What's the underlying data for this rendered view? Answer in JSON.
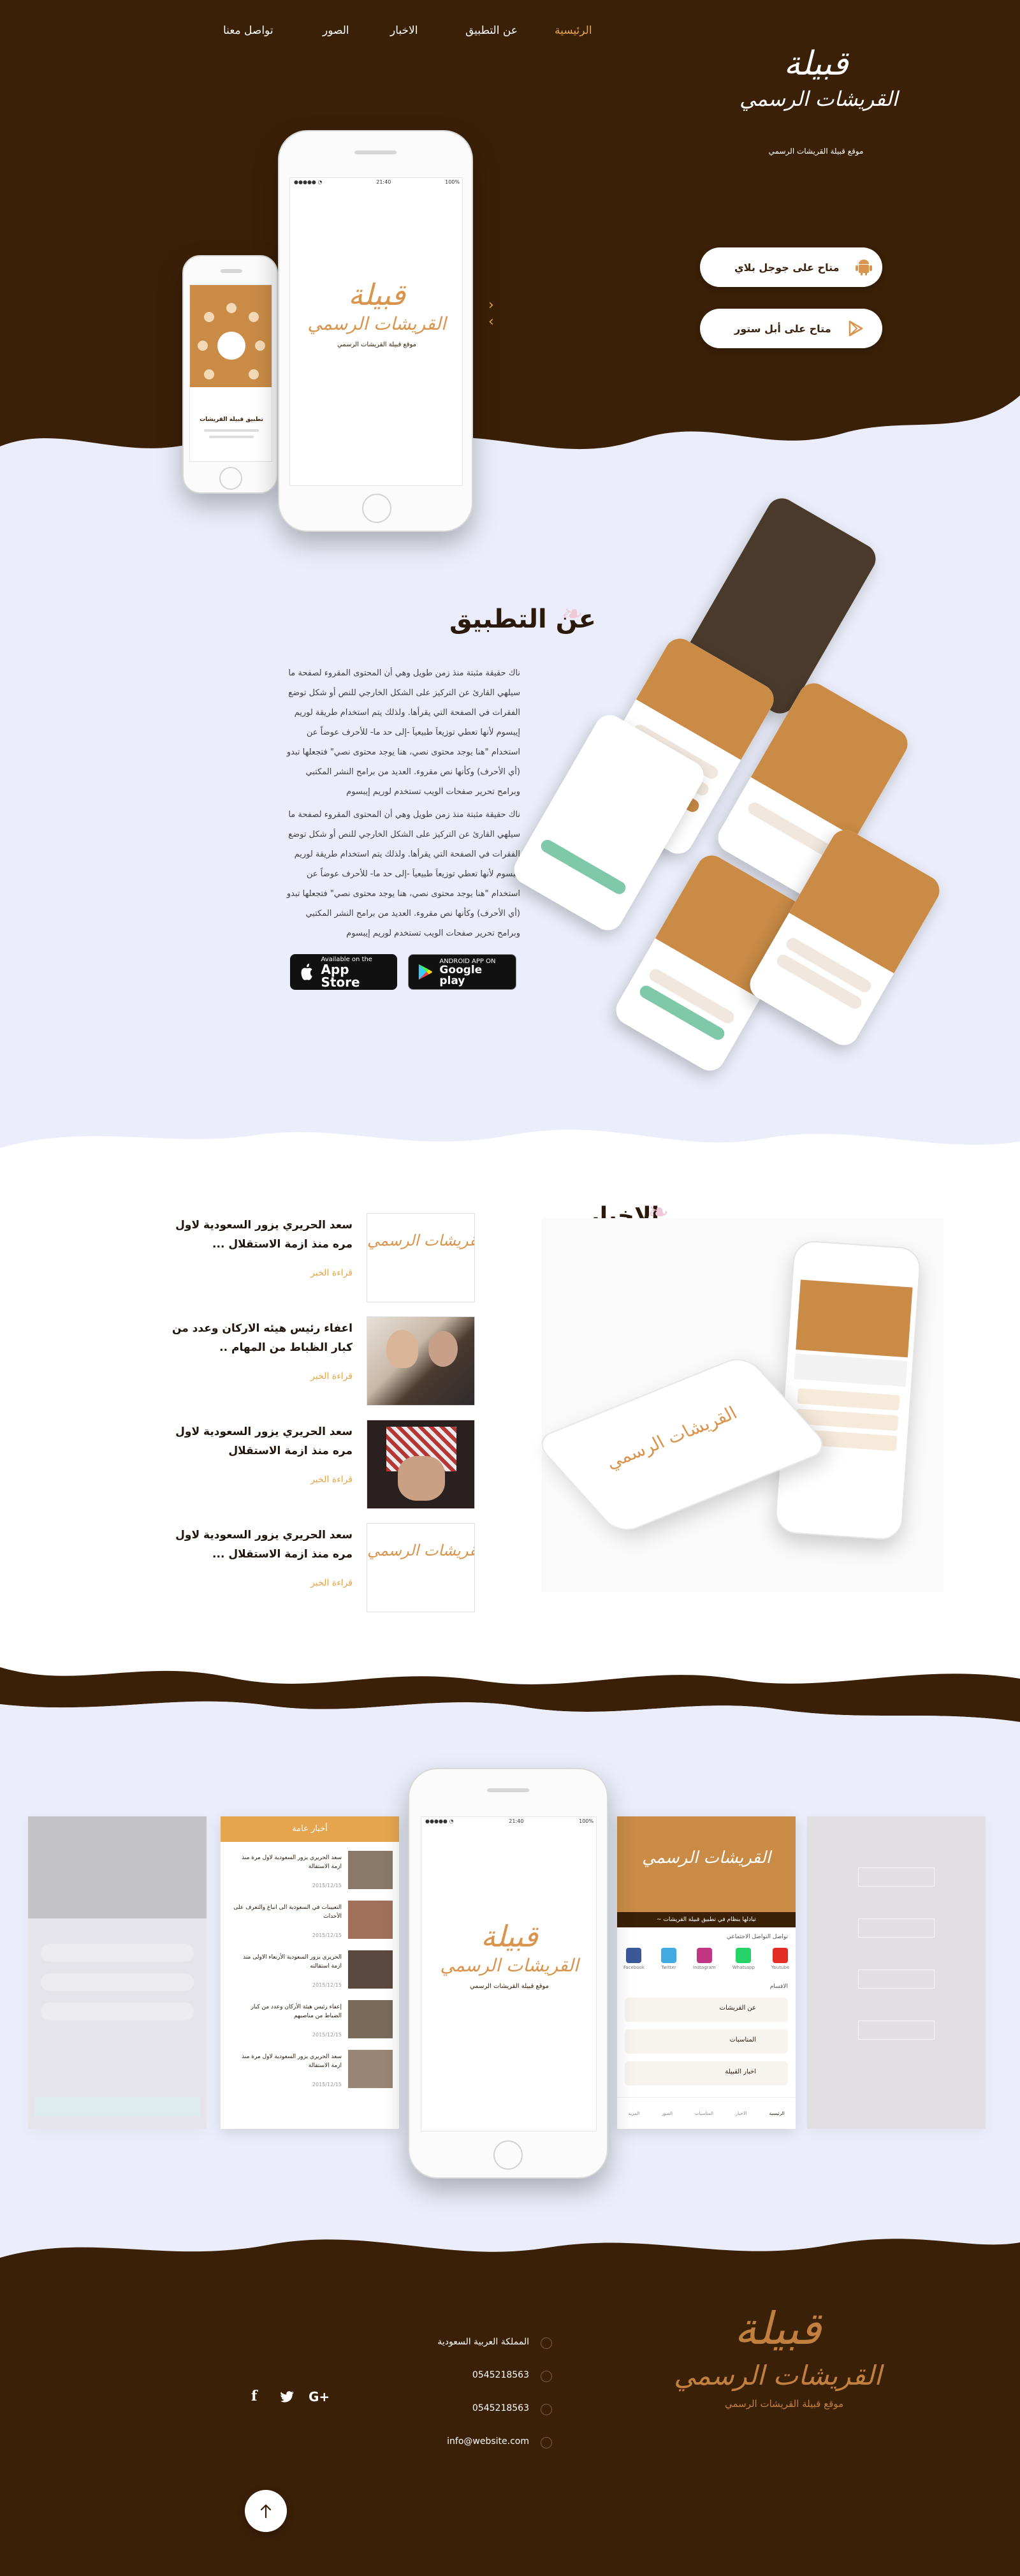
{
  "nav": {
    "items": [
      {
        "label": "الرئيسية",
        "active": true
      },
      {
        "label": "عن التطبيق",
        "active": false
      },
      {
        "label": "الاخبار",
        "active": false
      },
      {
        "label": "الصور",
        "active": false
      },
      {
        "label": "تواصل معنا",
        "active": false
      }
    ]
  },
  "brand": {
    "logo_line1": "قبيلة",
    "logo_line2": "القريشات الرسمي",
    "tagline": "موقع قبيلة القريشات الرسمي"
  },
  "hero": {
    "google_play_label": "متاح على جوجل بلاي",
    "app_store_label": "متاح على أبل ستور",
    "phone_status_time": "21:40",
    "phone_status_battery": "100%",
    "small_phone_caption": "تطبيق قبيلة القريشات"
  },
  "about": {
    "title": "عن التطبيق",
    "paragraph_1": "ناك حقيقة مثبتة منذ زمن طويل وهي أن المحتوى المقروء لصفحة ما سيلهي القارئ عن التركيز على الشكل الخارجي للنص أو شكل توضع الفقرات في الصفحة التي يقرأها. ولذلك يتم استخدام طريقة لوريم إيبسوم لأنها تعطي توزيعاَ طبيعياَ -إلى حد ما- للأحرف عوضاً عن استخدام \"هنا يوجد محتوى نصي، هنا يوجد محتوى نصي\" فتجعلها تبدو (أي الأحرف) وكأنها نص مقروء. العديد من برامح النشر المكتبي وبرامح تحرير صفحات الويب تستخدم لوريم إيبسوم",
    "paragraph_2": "ناك حقيقة مثبتة منذ زمن طويل وهي أن المحتوى المقروء لصفحة ما سيلهي القارئ عن التركيز على الشكل الخارجي للنص أو شكل توضع الفقرات في الصفحة التي يقرأها. ولذلك يتم استخدام طريقة لوريم إيبسوم لأنها تعطي توزيعاَ طبيعياَ -إلى حد ما- للأحرف عوضاً عن استخدام \"هنا يوجد محتوى نصي، هنا يوجد محتوى نصي\" فتجعلها تبدو (أي الأحرف) وكأنها نص مقروء. العديد من برامح النشر المكتبي وبرامح تحرير صفحات الويب تستخدم لوريم إيبسوم",
    "app_store_small": "Available on the",
    "app_store_big": "App Store",
    "google_small": "ANDROID APP ON",
    "google_big": "Google play"
  },
  "news": {
    "title": "الاخبار",
    "items": [
      {
        "title": "سعد الحريري يزور السعودية لاول مره منذ ازمة الاستقلال ...",
        "more": "قراءة الخبر",
        "thumb": "logo"
      },
      {
        "title": "اعفاء رئيس هيئه الاركان وعدد من كبار الظباط من المهام ..",
        "more": "قراءة الخبر",
        "thumb": "photo"
      },
      {
        "title": "سعد الحريري يزور السعودية لاول مره منذ ازمة الاستقلال",
        "more": "قراءة الخبر",
        "thumb": "photo"
      },
      {
        "title": "سعد الحريري يزور السعودية لاول مره منذ ازمة الاستقلال ...",
        "more": "قراءة الخبر",
        "thumb": "logo"
      }
    ]
  },
  "screens": {
    "news_header": "أخبار عامة",
    "home_banner": "~ تبادلها بنظام في تطبيق قبيلة القريشات",
    "contact_header": "تواصل التواصل الاجتماعي",
    "socials": [
      "Facebook",
      "Twitter",
      "Instagram",
      "Whatsapp",
      "Youtube"
    ],
    "sections_label": "الاقسام",
    "sections": [
      "عن القريشات",
      "المناسبات",
      "اخبار القبيلة"
    ],
    "tabbar": [
      "الرئيسية",
      "الاخبار",
      "المناسبات",
      "الصور",
      "المزيد"
    ],
    "list_titles": [
      "سعد الحريري يزور السعودية لاول مرة منذ ازمة الاستقالة",
      "التعيينات في السعودية الى انباع والتعرف على الأحداث",
      "الحريري يزور السعودية الأربعاء الاولى منذ ازمة استقالته",
      "إعفاء رئيس هيئة الأركان وعدد من كبار الضباط من مناصبهم",
      "سعد الحريري يزور السعودية لاول مرة منذ ازمة الاستقالة"
    ],
    "list_date": "2015/12/15"
  },
  "footer": {
    "country": "المملكة العربية السعودية",
    "phone_1": "0545218563",
    "phone_2": "0545218563",
    "email": "info@website.com",
    "social_icons": [
      "facebook-icon",
      "twitter-icon",
      "google-plus-icon"
    ]
  },
  "colors": {
    "brown_dark": "#3b2008",
    "orange_accent": "#e5a54e",
    "bg_light": "#ebeefa",
    "logo_orange": "#d9954e"
  }
}
